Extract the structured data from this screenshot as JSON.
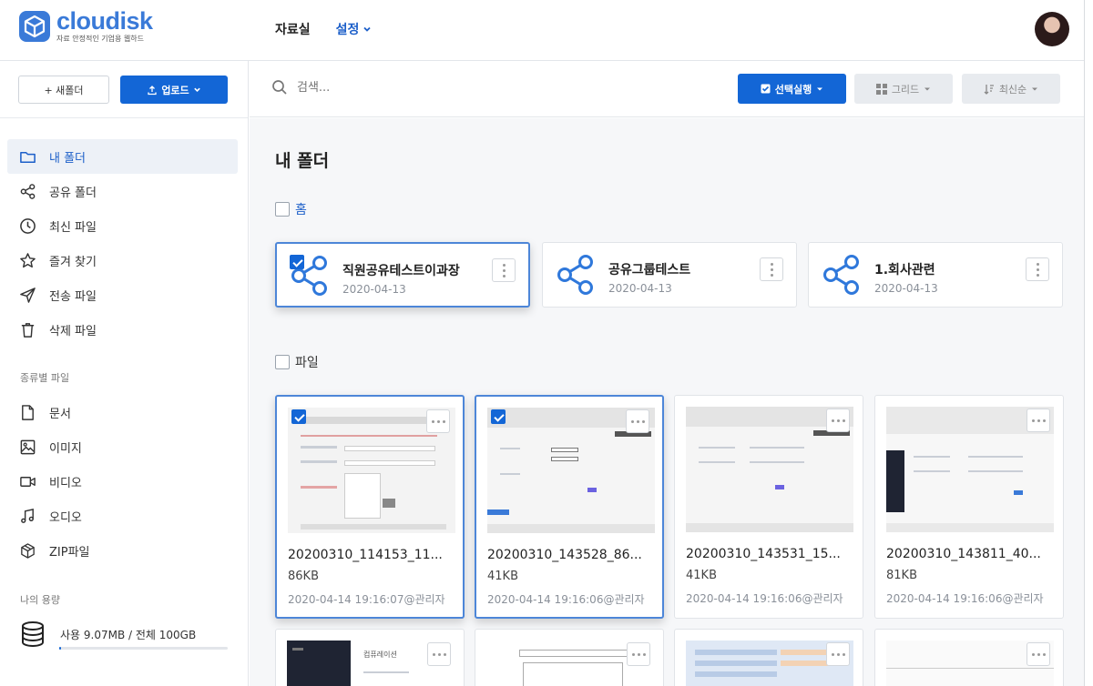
{
  "app": {
    "logo_name": "cloudisk",
    "logo_tagline": "자료 안정적인 기업용 웹하드",
    "brand_color": "#3a7ad8",
    "accent_color": "#1366d6"
  },
  "nav": {
    "items": [
      {
        "label": "자료실"
      },
      {
        "label": "설정",
        "icon": "chevron-down-icon"
      }
    ]
  },
  "sidebar": {
    "new_folder_label": "+ 새폴더",
    "upload_label": "업로드",
    "menu": [
      {
        "label": "내 폴더",
        "icon": "folder-icon",
        "active": true
      },
      {
        "label": "공유 폴더",
        "icon": "share-icon"
      },
      {
        "label": "최신 파일",
        "icon": "clock-icon"
      },
      {
        "label": "즐겨 찾기",
        "icon": "star-icon"
      },
      {
        "label": "전송 파일",
        "icon": "send-icon"
      },
      {
        "label": "삭제 파일",
        "icon": "trash-icon"
      }
    ],
    "types_title": "종류별 파일",
    "types": [
      {
        "label": "문서",
        "icon": "document-icon"
      },
      {
        "label": "이미지",
        "icon": "image-icon"
      },
      {
        "label": "비디오",
        "icon": "video-icon"
      },
      {
        "label": "오디오",
        "icon": "music-icon"
      },
      {
        "label": "ZIP파일",
        "icon": "package-icon"
      }
    ],
    "storage_title": "나의 용량",
    "storage_text": "사용 9.07MB / 전체 100GB",
    "storage_used_fraction": 0.0001
  },
  "toolbar": {
    "search_placeholder": "검색...",
    "select_action_label": "선택실행",
    "view_label": "그리드",
    "sort_label": "최신순"
  },
  "main": {
    "title": "내 폴더",
    "folders_group_label": "홈",
    "folders": [
      {
        "name": "직원공유테스트이과장",
        "date": "2020-04-13",
        "selected": true
      },
      {
        "name": "공유그룹테스트",
        "date": "2020-04-13",
        "selected": false
      },
      {
        "name": "1.회사관련",
        "date": "2020-04-13",
        "selected": false
      }
    ],
    "files_group_label": "파일",
    "files": [
      {
        "name": "20200310_114153_11...",
        "size": "86KB",
        "meta": "2020-04-14 19:16:07@관리자",
        "selected": true
      },
      {
        "name": "20200310_143528_86...",
        "size": "41KB",
        "meta": "2020-04-14 19:16:06@관리자",
        "selected": true
      },
      {
        "name": "20200310_143531_15...",
        "size": "41KB",
        "meta": "2020-04-14 19:16:06@관리자",
        "selected": false
      },
      {
        "name": "20200310_143811_40...",
        "size": "81KB",
        "meta": "2020-04-14 19:16:06@관리자",
        "selected": false
      }
    ],
    "row2_thumb_title": "컴퓨레이션"
  }
}
